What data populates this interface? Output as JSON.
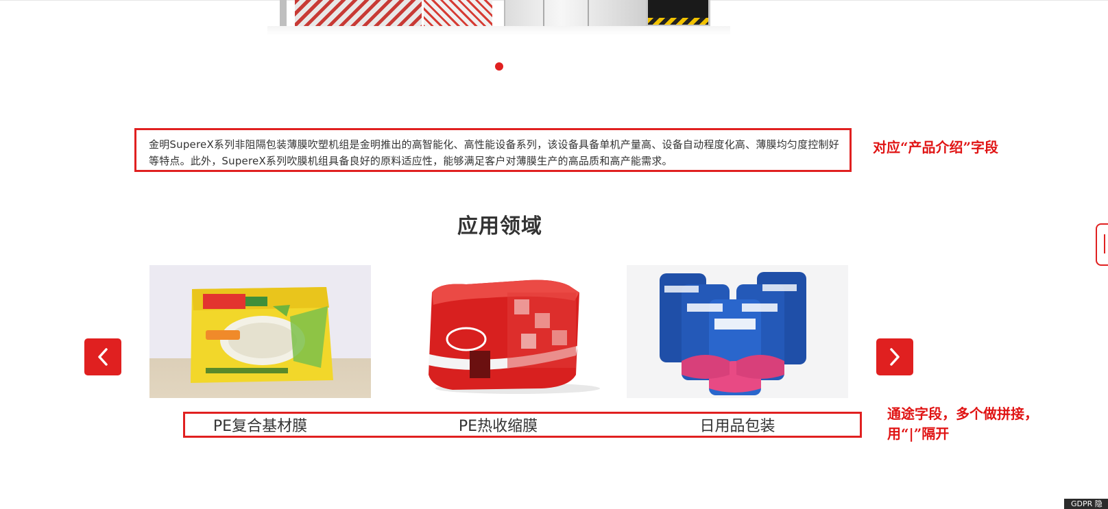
{
  "intro": {
    "text": "金明SupereX系列非阻隔包装薄膜吹塑机组是金明推出的高智能化、高性能设备系列，该设备具备单机产量高、设备自动程度化高、薄膜均匀度控制好等特点。此外，SupereX系列吹膜机组具备良好的原料适应性，能够满足客户对薄膜生产的高品质和高产能需求。"
  },
  "annotations": {
    "intro_note": "对应“产品介绍”字段",
    "usage_note_line1": "通途字段，多个做拼接，",
    "usage_note_line2": "用“|”隔开"
  },
  "applications": {
    "title": "应用领域",
    "items": [
      {
        "label": "PE复合基材膜",
        "image_icon": "frozen-dumpling-package"
      },
      {
        "label": "PE热收缩膜",
        "image_icon": "shrink-wrapped-cola-cans"
      },
      {
        "label": "日用品包装",
        "image_icon": "detergent-refill-pouches"
      }
    ],
    "prev_icon": "chevron-left-icon",
    "next_icon": "chevron-right-icon"
  },
  "gdpr": {
    "label": "GDPR 隐"
  },
  "colors": {
    "accent": "#e02020",
    "text": "#333333",
    "annotation": "#e01414"
  }
}
